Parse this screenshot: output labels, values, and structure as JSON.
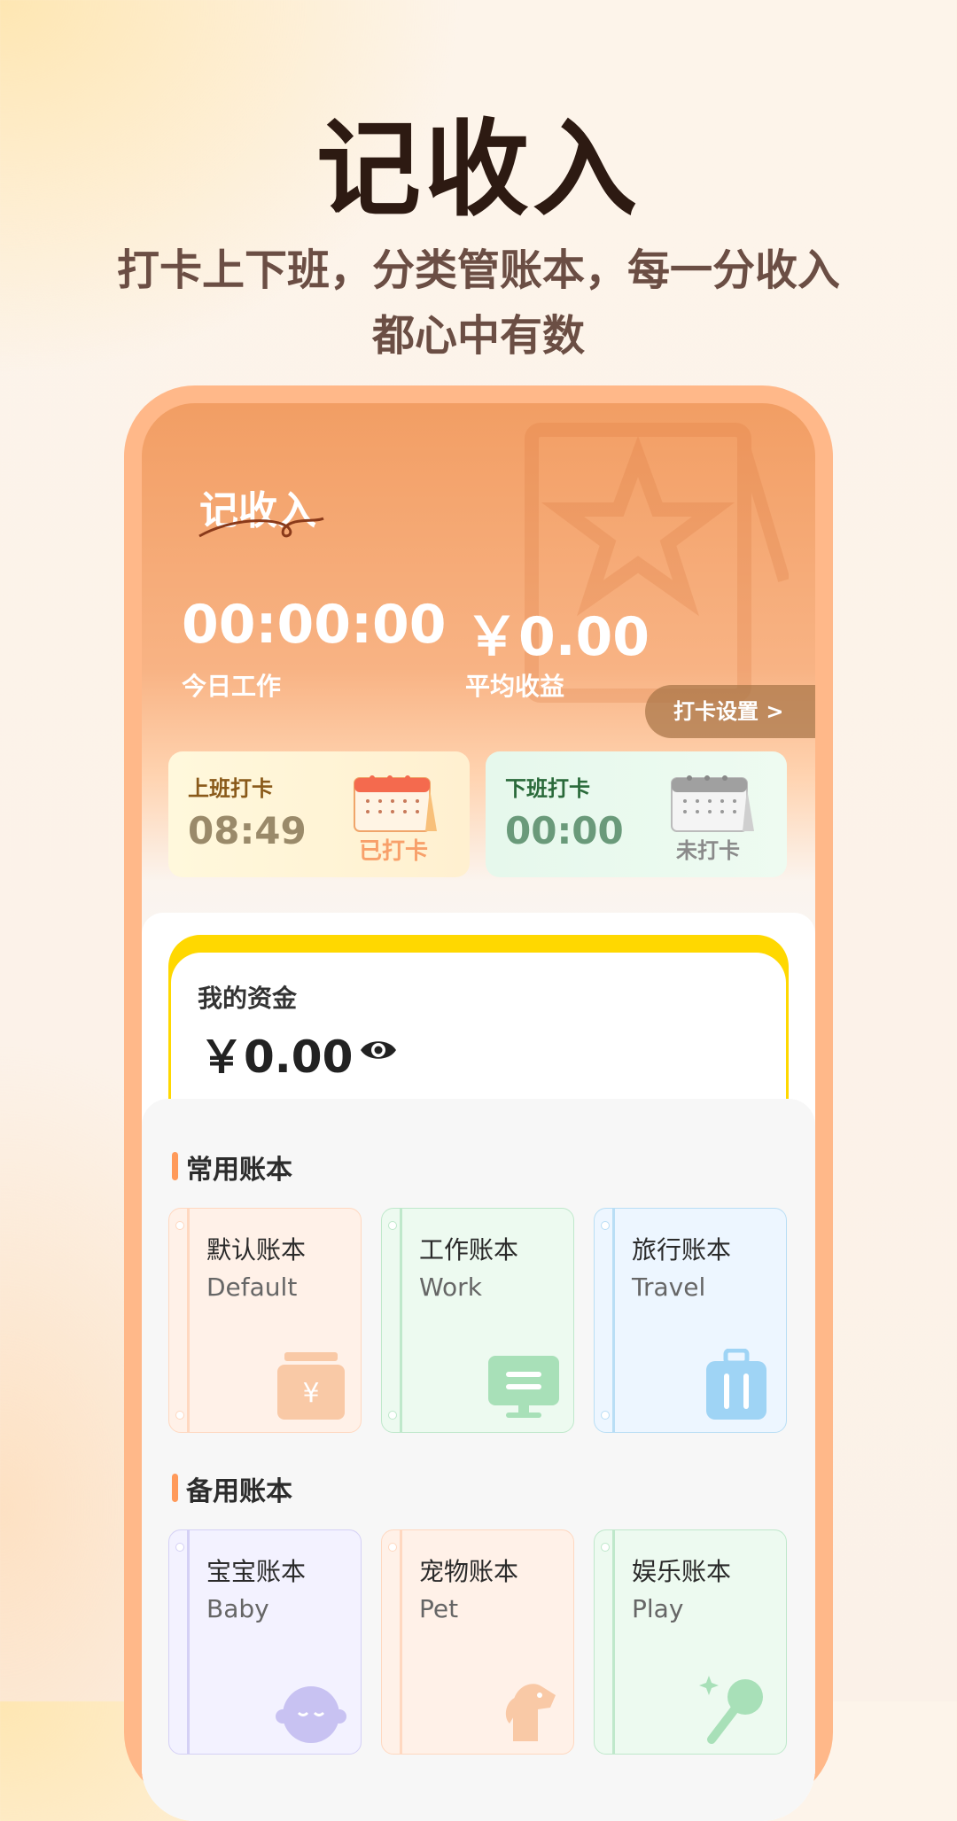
{
  "promo": {
    "title": "记收入",
    "subtitle_line1": "打卡上下班，分类管账本，每一分收入",
    "subtitle_line2": "都心中有数"
  },
  "app": {
    "logo_text": "记收入",
    "work_time_value": "00:00:00",
    "work_time_label": "今日工作",
    "avg_income_value": "￥0.00",
    "avg_income_label": "平均收益",
    "settings_button": "打卡设置 >",
    "clock_in": {
      "label": "上班打卡",
      "time": "08:49",
      "status": "已打卡"
    },
    "clock_out": {
      "label": "下班打卡",
      "time": "00:00",
      "status": "未打卡"
    },
    "funds": {
      "label": "我的资金",
      "value": "￥0.00"
    },
    "common_books": {
      "title": "常用账本",
      "items": [
        {
          "name": "默认账本",
          "en": "Default",
          "icon": "money-box-icon",
          "color": "#f9c9a6"
        },
        {
          "name": "工作账本",
          "en": "Work",
          "icon": "monitor-icon",
          "color": "#a8e0b8"
        },
        {
          "name": "旅行账本",
          "en": "Travel",
          "icon": "suitcase-icon",
          "color": "#9fd4f5"
        }
      ]
    },
    "spare_books": {
      "title": "备用账本",
      "items": [
        {
          "name": "宝宝账本",
          "en": "Baby",
          "icon": "baby-icon",
          "color": "#c8c2f2"
        },
        {
          "name": "宠物账本",
          "en": "Pet",
          "icon": "dog-icon",
          "color": "#f9c9a6"
        },
        {
          "name": "娱乐账本",
          "en": "Play",
          "icon": "microphone-icon",
          "color": "#a8e0b8"
        }
      ]
    }
  }
}
